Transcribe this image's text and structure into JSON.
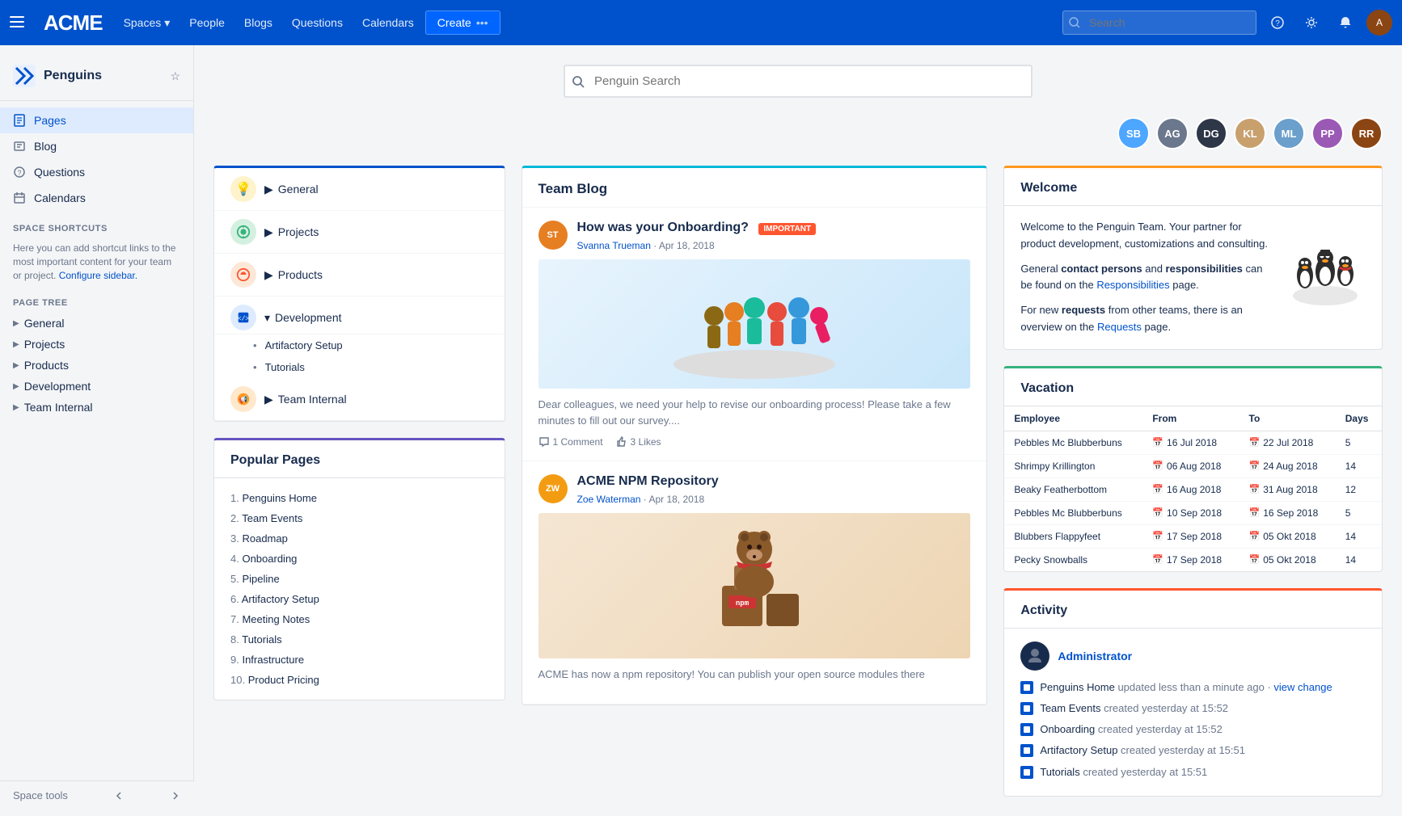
{
  "topnav": {
    "logo": "ACME",
    "nav_items": [
      {
        "label": "Spaces",
        "has_dropdown": true
      },
      {
        "label": "People",
        "has_dropdown": false
      },
      {
        "label": "Blogs",
        "has_dropdown": false
      },
      {
        "label": "Questions",
        "has_dropdown": false
      },
      {
        "label": "Calendars",
        "has_dropdown": false
      }
    ],
    "create_label": "Create",
    "search_placeholder": "Search"
  },
  "sidebar": {
    "space_name": "Penguins",
    "nav_items": [
      {
        "label": "Pages",
        "icon": "pages"
      },
      {
        "label": "Blog",
        "icon": "blog"
      },
      {
        "label": "Questions",
        "icon": "questions"
      },
      {
        "label": "Calendars",
        "icon": "calendars"
      }
    ],
    "shortcuts_title": "SPACE SHORTCUTS",
    "shortcuts_text": "Here you can add shortcut links to the most important content for your team or project.",
    "configure_label": "Configure sidebar.",
    "page_tree_title": "PAGE TREE",
    "tree_items": [
      {
        "label": "General"
      },
      {
        "label": "Projects"
      },
      {
        "label": "Products"
      },
      {
        "label": "Development"
      },
      {
        "label": "Team Internal"
      }
    ],
    "tools_label": "Space tools"
  },
  "page": {
    "search_placeholder": "Penguin Search",
    "avatars": [
      {
        "initials": "SB",
        "color": "#4da6ff"
      },
      {
        "initials": "AG",
        "color": "#6b778c"
      },
      {
        "initials": "DG",
        "color": "#2d3748"
      },
      {
        "initials": "KL",
        "color": "#c8a06e"
      },
      {
        "initials": "ML",
        "color": "#6b9fcc"
      },
      {
        "initials": "PP",
        "color": "#9b59b6"
      },
      {
        "initials": "RR",
        "color": "#8B4513"
      }
    ]
  },
  "page_tree_card": {
    "items": [
      {
        "label": "General",
        "icon_bg": "#ffab00",
        "icon": "💡"
      },
      {
        "label": "Projects",
        "icon_bg": "#36b37e",
        "icon": "🎯"
      },
      {
        "label": "Products",
        "icon_bg": "#ff5630",
        "icon": "🎯",
        "expanded": false
      },
      {
        "label": "Development",
        "icon_bg": "#0052cc",
        "icon": "💻",
        "expanded": true,
        "sub_items": [
          "Artifactory Setup",
          "Tutorials"
        ]
      },
      {
        "label": "Team Internal",
        "icon_bg": "#ff991f",
        "icon": "📢"
      }
    ]
  },
  "popular_pages": {
    "title": "Popular Pages",
    "items": [
      "Penguins Home",
      "Team Events",
      "Roadmap",
      "Onboarding",
      "Pipeline",
      "Artifactory Setup",
      "Meeting Notes",
      "Tutorials",
      "Infrastructure",
      "Product Pricing"
    ]
  },
  "team_blog": {
    "title": "Team Blog",
    "posts": [
      {
        "title": "How was your Onboarding?",
        "author": "Svanna Trueman",
        "date": "Apr 18, 2018",
        "badge": "important",
        "excerpt": "Dear colleagues, we need your help to revise our onboarding process! Please take a few minutes to fill out our survey....",
        "comments": "1 Comment",
        "likes": "3 Likes",
        "avatar_color": "#e67e22"
      },
      {
        "title": "ACME NPM Repository",
        "author": "Zoe Waterman",
        "date": "Apr 18, 2018",
        "excerpt": "ACME has now a npm repository! You can publish your open source modules there",
        "avatar_color": "#f39c12"
      }
    ]
  },
  "welcome": {
    "title": "Welcome",
    "text1": "Welcome to the Penguin Team. Your partner for product development, customizations and consulting.",
    "text2": "General",
    "text2b": "contact persons",
    "text2c": "and",
    "text2d": "responsibilities",
    "text2e": "can be found on the",
    "responsibilities_link": "Responsibilities",
    "text3_pre": "For new",
    "requests_word": "requests",
    "text3_mid": "from other teams, there is an overview on the",
    "requests_link": "Requests",
    "text3_post": "page."
  },
  "vacation": {
    "title": "Vacation",
    "columns": [
      "Employee",
      "From",
      "To",
      "Days"
    ],
    "rows": [
      {
        "employee": "Pebbles Mc Blubberbuns",
        "from": "16 Jul 2018",
        "to": "22 Jul 2018",
        "days": "5"
      },
      {
        "employee": "Shrimpy Krillington",
        "from": "06 Aug 2018",
        "to": "24 Aug 2018",
        "days": "14"
      },
      {
        "employee": "Beaky Featherbottom",
        "from": "16 Aug 2018",
        "to": "31 Aug 2018",
        "days": "12"
      },
      {
        "employee": "Pebbles Mc Blubberbuns",
        "from": "10 Sep 2018",
        "to": "16 Sep 2018",
        "days": "5"
      },
      {
        "employee": "Blubbers Flappyfeet",
        "from": "17 Sep 2018",
        "to": "05 Okt 2018",
        "days": "14"
      },
      {
        "employee": "Pecky Snowballs",
        "from": "17 Sep 2018",
        "to": "05 Okt 2018",
        "days": "14"
      }
    ]
  },
  "activity": {
    "title": "Activity",
    "user": "Administrator",
    "items": [
      {
        "text": "Penguins Home",
        "action": "updated less than a minute ago",
        "link": "view change"
      },
      {
        "text": "Team Events",
        "action": "created yesterday at 15:52"
      },
      {
        "text": "Onboarding",
        "action": "created yesterday at 15:52"
      },
      {
        "text": "Artifactory Setup",
        "action": "created yesterday at 15:51"
      },
      {
        "text": "Tutorials",
        "action": "created yesterday at 15:51"
      }
    ]
  }
}
